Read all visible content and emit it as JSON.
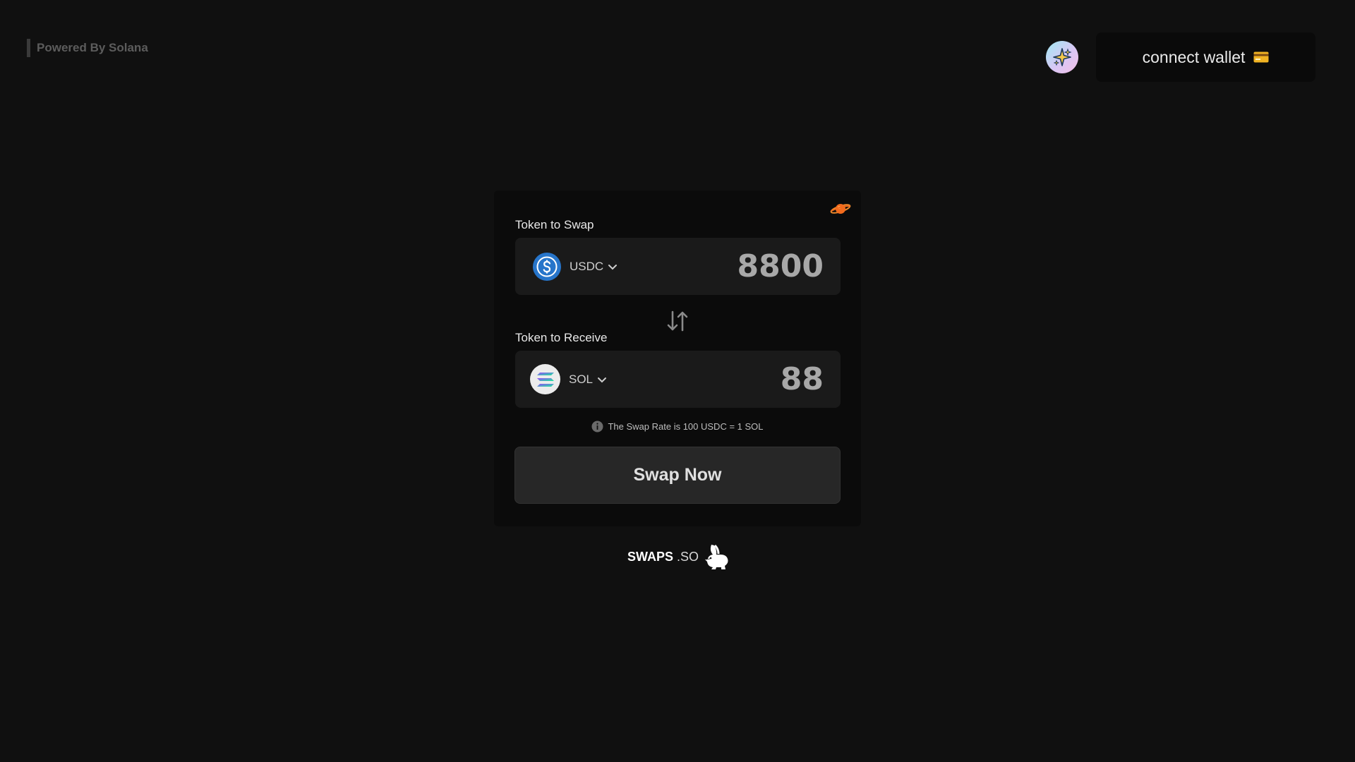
{
  "header": {
    "powered_by": "Powered By Solana",
    "connect_wallet_label": "connect wallet"
  },
  "swap": {
    "from_label": "Token to Swap",
    "from_token": "USDC",
    "from_amount": "8800",
    "to_label": "Token to Receive",
    "to_token": "SOL",
    "to_amount": "88",
    "rate_text": "The Swap Rate is 100 USDC = 1 SOL",
    "swap_button_label": "Swap Now"
  },
  "footer": {
    "brand_name": "SWAPS",
    "brand_suffix": ".SO"
  },
  "icons": {
    "theme": "sparkle-icon",
    "wallet": "credit-card-icon",
    "planet": "planet-icon",
    "usdc": "usdc-token-icon",
    "sol": "sol-token-icon",
    "swap_direction": "swap-arrows-icon",
    "info": "info-icon",
    "mascot": "rabbit-icon"
  },
  "colors": {
    "background": "#101010",
    "card": "#0b0b0b",
    "field": "#1a1a1a",
    "button": "#272727",
    "usdc_blue": "#2775ca",
    "planet_orange": "#f26b1d"
  }
}
